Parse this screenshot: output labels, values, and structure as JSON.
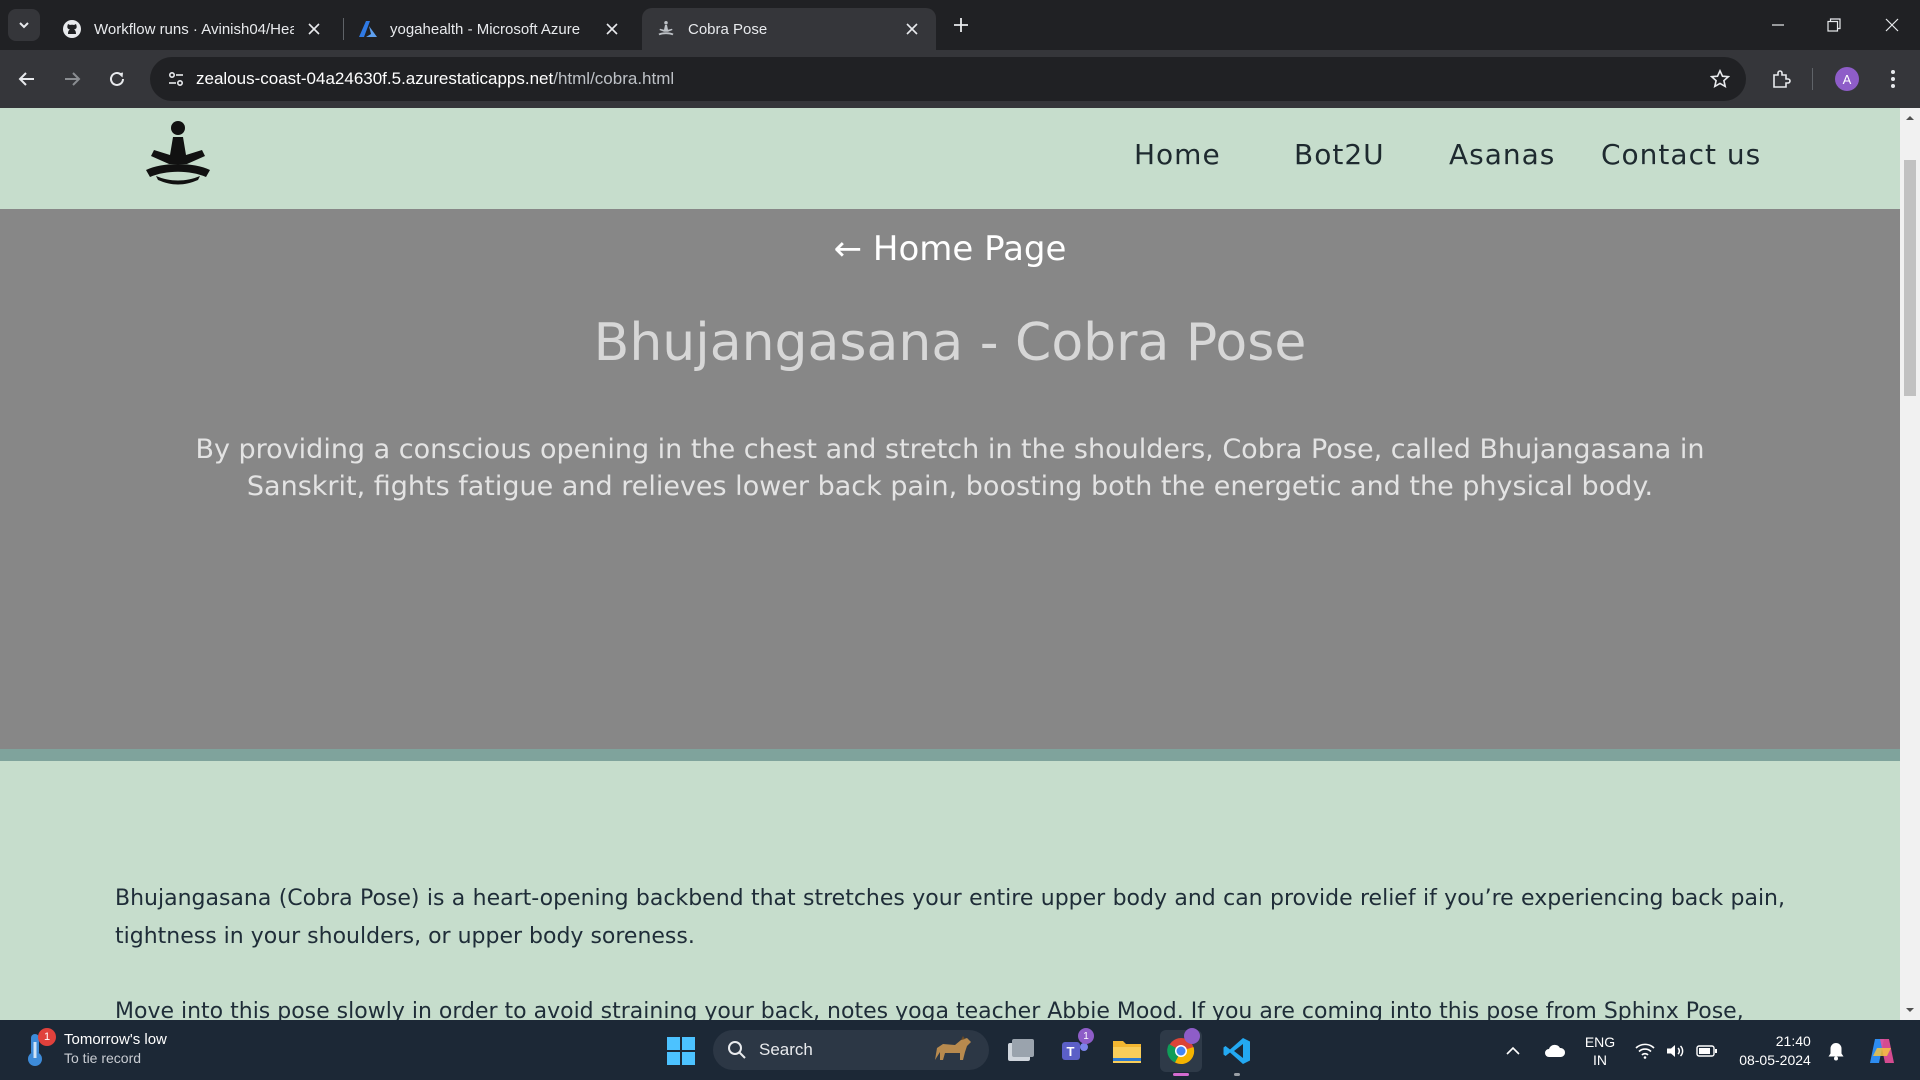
{
  "browser": {
    "tabs": [
      {
        "title": "Workflow runs · Avinish04/Heal",
        "favicon": "github-icon",
        "active": false
      },
      {
        "title": "yogahealth - Microsoft Azure",
        "favicon": "azure-icon",
        "active": false
      },
      {
        "title": "Cobra Pose",
        "favicon": "yoga-pose-icon",
        "active": true
      }
    ],
    "url_host": "zealous-coast-04a24630f.5.azurestaticapps.net",
    "url_path": "/html/cobra.html",
    "profile_initial": "A"
  },
  "site": {
    "nav": {
      "home": "Home",
      "bot": "Bot2U",
      "asanas": "Asanas",
      "contact": "Contact us"
    },
    "hero": {
      "back_link": "← Home Page",
      "title": "Bhujangasana - Cobra Pose",
      "description": "By providing a conscious opening in the chest and stretch in the shoulders, Cobra Pose, called Bhujangasana in Sanskrit, fights fatigue and relieves lower back pain, boosting both the energetic and the physical body."
    },
    "content": {
      "paragraph1": "Bhujangasana (Cobra Pose) is a heart-opening backbend that stretches your entire upper body and can provide relief if you’re experiencing back pain, tightness in your shoulders, or upper body soreness.",
      "paragraph2": "Move into this pose slowly in order to avoid straining your back, notes yoga teacher Abbie Mood. If you are coming into this pose from Sphinx Pose,"
    },
    "colors": {
      "header_bg": "#c6ddcc",
      "hero_bg": "#878787",
      "accent_strip": "#7fa39c"
    }
  },
  "taskbar": {
    "weather_title": "Tomorrow's low",
    "weather_sub": "To tie record",
    "weather_badge": "1",
    "search_placeholder": "Search",
    "teams_badge": "1",
    "lang_line1": "ENG",
    "lang_line2": "IN",
    "time": "21:40",
    "date": "08-05-2024"
  }
}
